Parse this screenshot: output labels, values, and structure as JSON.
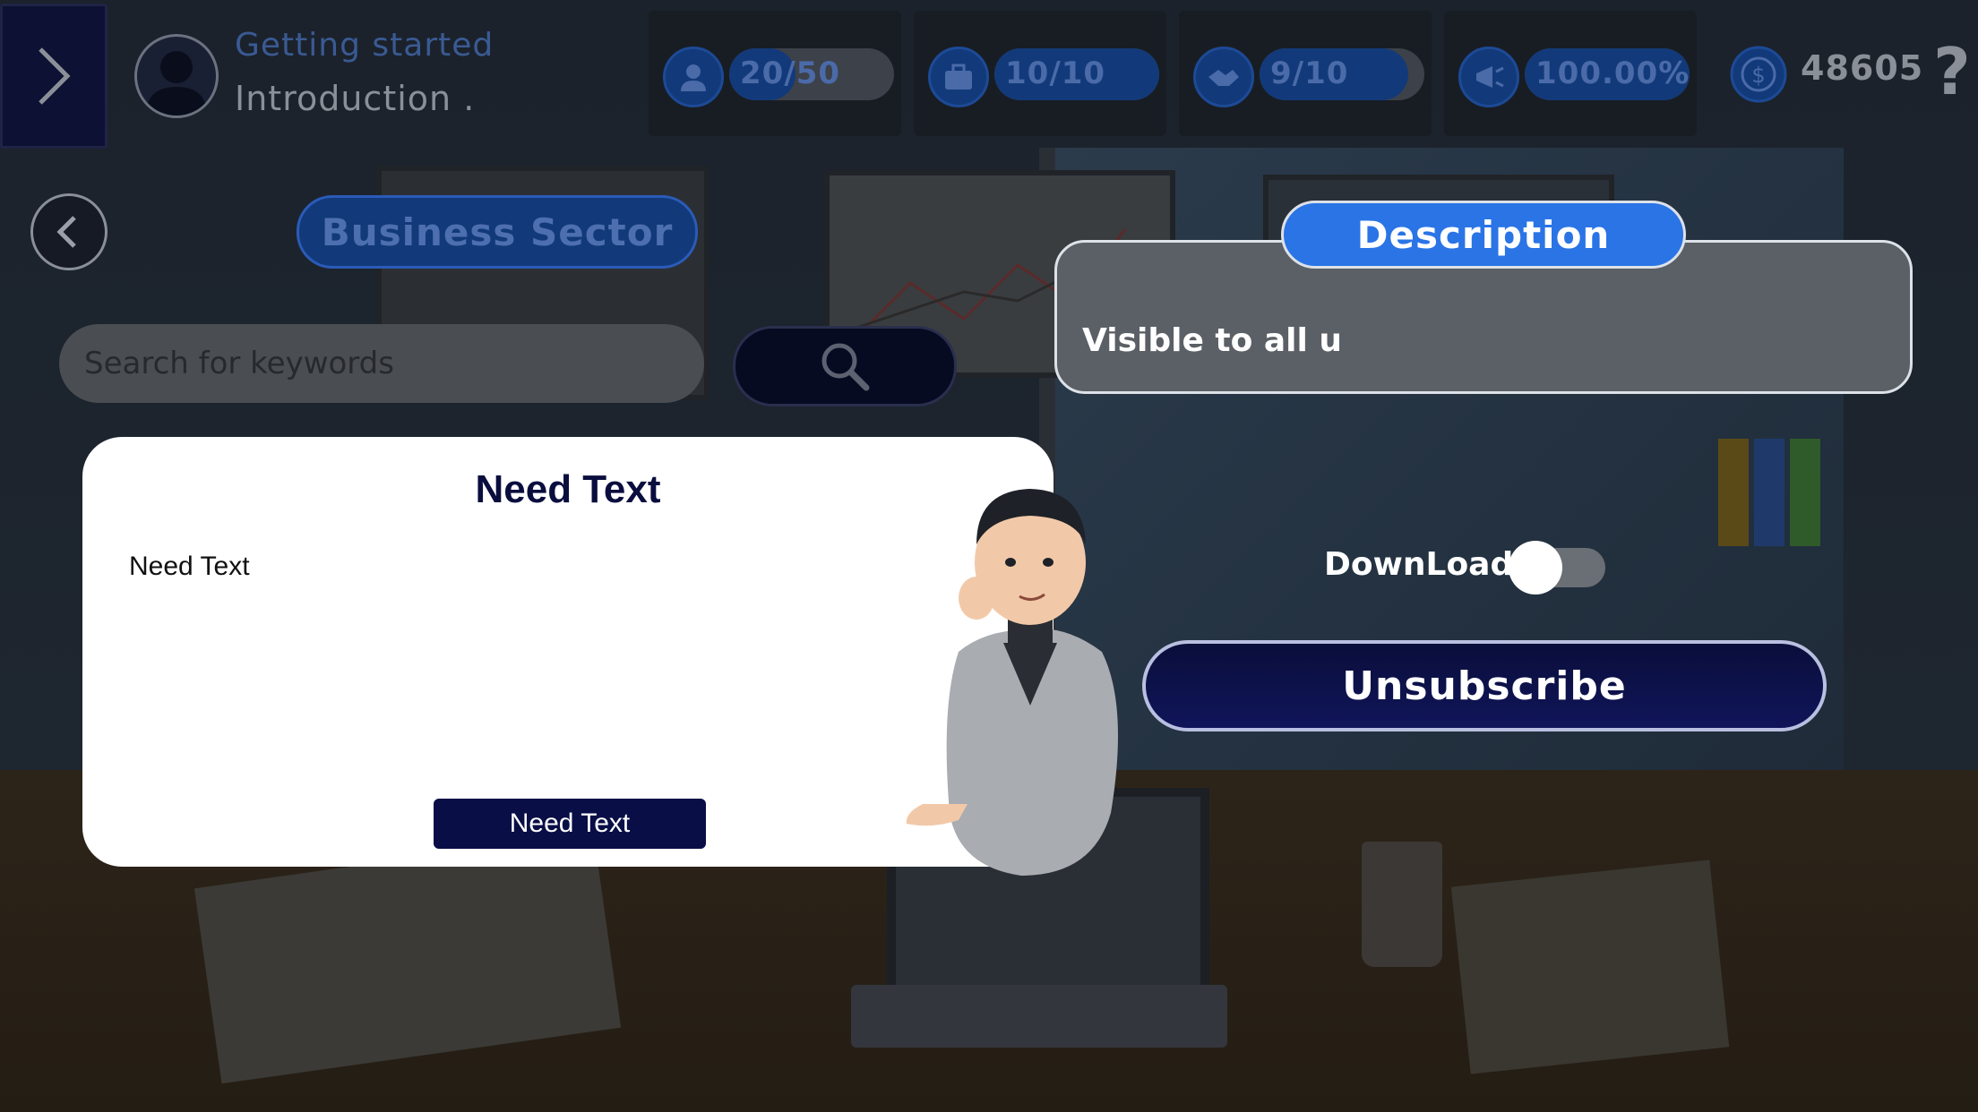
{
  "header": {
    "level_title": "Getting started",
    "level_subtitle": "Introduction .",
    "stats": [
      {
        "icon": "employee-icon",
        "label": "20/50",
        "fraction": 0.4
      },
      {
        "icon": "briefcase-icon",
        "label": "10/10",
        "fraction": 1.0
      },
      {
        "icon": "handshake-icon",
        "label": "9/10",
        "fraction": 0.9
      },
      {
        "icon": "megaphone-icon",
        "label": "100.00%",
        "fraction": 1.0
      }
    ],
    "coins": "48605",
    "help": "?"
  },
  "sector": {
    "label": "Business Sector"
  },
  "search": {
    "placeholder": "Search for keywords",
    "value": ""
  },
  "description": {
    "tab_label": "Description",
    "text": "Visible to all u"
  },
  "download": {
    "label": "DownLoad",
    "enabled": false
  },
  "unsubscribe": {
    "label": "Unsubscribe"
  },
  "dialog": {
    "title": "Need Text",
    "body": "Need Text",
    "button": "Need Text"
  },
  "colors": {
    "accent_blue": "#2a74e6",
    "navy": "#0a0e46",
    "stat_blue": "#123a7a"
  }
}
